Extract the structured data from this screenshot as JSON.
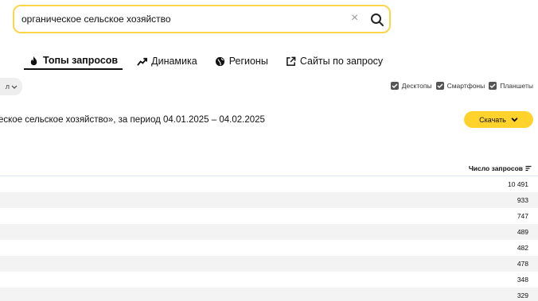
{
  "search": {
    "query": "органическое сельское хозяйство",
    "clear_glyph": "×"
  },
  "tabs": [
    {
      "label": "Топы запросов",
      "icon": "fire-icon",
      "active": true
    },
    {
      "label": "Динамика",
      "icon": "trend-icon",
      "active": false
    },
    {
      "label": "Регионы",
      "icon": "globe-icon",
      "active": false
    },
    {
      "label": "Сайты по запросу",
      "icon": "external-link-icon",
      "active": false
    }
  ],
  "period_chip": {
    "label": "л"
  },
  "devices": [
    {
      "label": "Десктопы",
      "checked": true
    },
    {
      "label": "Смартфоны",
      "checked": true
    },
    {
      "label": "Планшеты",
      "checked": true
    }
  ],
  "summary": "еское сельское хозяйство», за период 04.01.2025 – 04.02.2025",
  "download": {
    "label": "Скачать"
  },
  "table": {
    "column_header": "Число запросов",
    "values": [
      "10 491",
      "933",
      "747",
      "489",
      "482",
      "478",
      "348",
      "329"
    ]
  },
  "colors": {
    "accent": "#ffd32c",
    "search_border": "#fcd54a"
  }
}
